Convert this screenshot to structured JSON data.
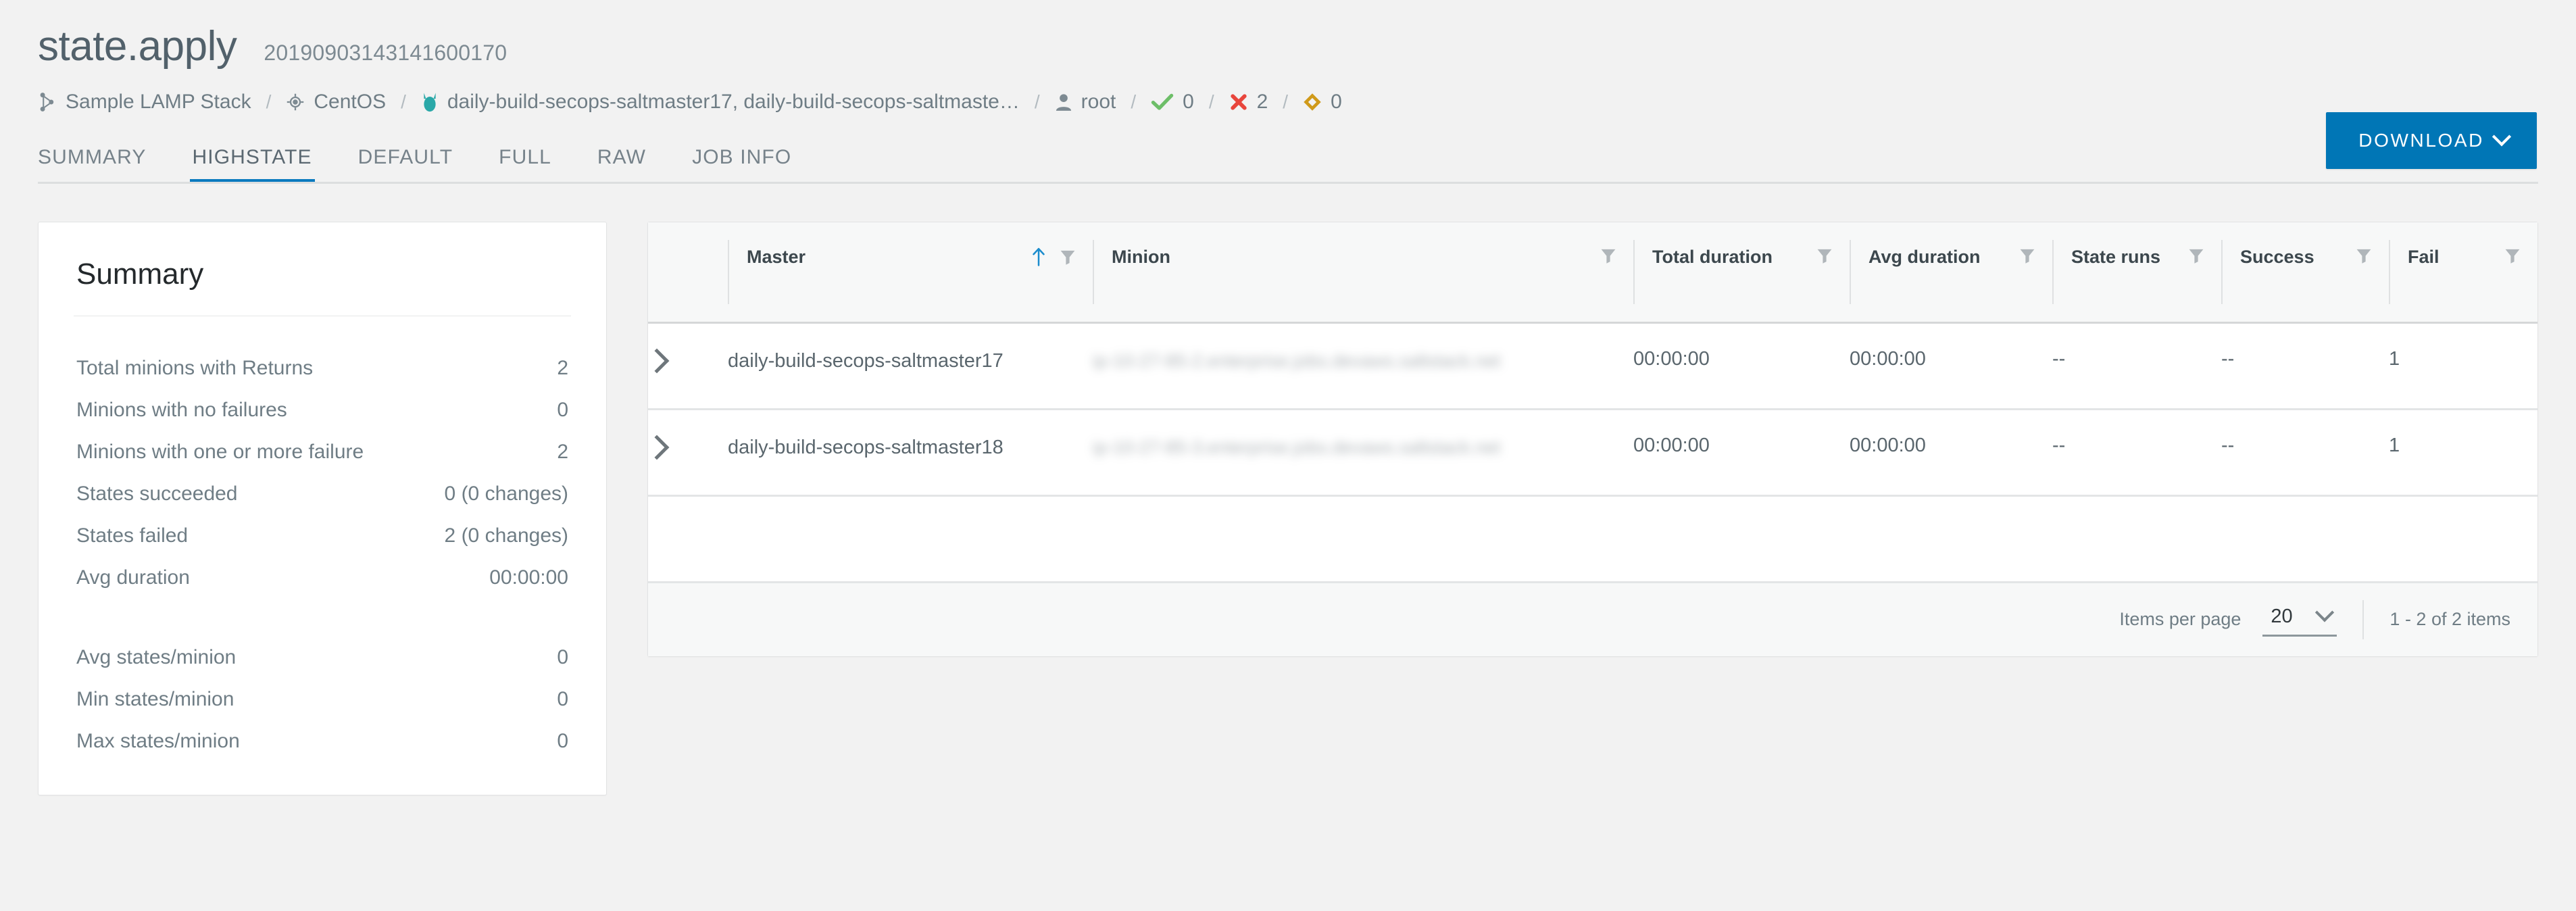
{
  "header": {
    "title": "state.apply",
    "job_id": "20190903143141600170"
  },
  "breadcrumb": {
    "items": [
      {
        "icon": "nodes-icon",
        "label": "Sample LAMP Stack"
      },
      {
        "icon": "target-icon",
        "label": "CentOS"
      },
      {
        "icon": "salt-minion-icon",
        "label": "daily-build-secops-saltmaster17, daily-build-secops-saltmaste…"
      },
      {
        "icon": "user-icon",
        "label": "root"
      },
      {
        "icon": "check-icon",
        "label": "0",
        "color": "#6dbe68"
      },
      {
        "icon": "x-icon",
        "label": "2",
        "color": "#e8453c"
      },
      {
        "icon": "diamond-icon",
        "label": "0",
        "color": "#d09a1a"
      }
    ],
    "separator": "/"
  },
  "tabs": {
    "items": [
      {
        "label": "SUMMARY",
        "active": false
      },
      {
        "label": "HIGHSTATE",
        "active": true
      },
      {
        "label": "DEFAULT",
        "active": false
      },
      {
        "label": "FULL",
        "active": false
      },
      {
        "label": "RAW",
        "active": false
      },
      {
        "label": "JOB INFO",
        "active": false
      }
    ],
    "active_color": "#0a7abf"
  },
  "toolbar": {
    "download_label": "DOWNLOAD",
    "download_color": "#0076b6"
  },
  "summary": {
    "title": "Summary",
    "group_one": [
      {
        "label": "Total minions with Returns",
        "value": "2"
      },
      {
        "label": "Minions with no failures",
        "value": "0"
      },
      {
        "label": "Minions with one or more failure",
        "value": "2"
      },
      {
        "label": "States succeeded",
        "value": "0 (0 changes)"
      },
      {
        "label": "States failed",
        "value": "2 (0 changes)"
      },
      {
        "label": "Avg duration",
        "value": "00:00:00"
      }
    ],
    "group_two": [
      {
        "label": "Avg states/minion",
        "value": "0"
      },
      {
        "label": "Min states/minion",
        "value": "0"
      },
      {
        "label": "Max states/minion",
        "value": "0"
      }
    ]
  },
  "table": {
    "columns": [
      {
        "key": "expand",
        "label": "",
        "sorted": false,
        "filter": false
      },
      {
        "key": "master",
        "label": "Master",
        "sorted": true,
        "sort_dir": "asc",
        "filter": true
      },
      {
        "key": "minion",
        "label": "Minion",
        "sorted": false,
        "filter": true
      },
      {
        "key": "total_duration",
        "label": "Total duration",
        "sorted": false,
        "filter": true
      },
      {
        "key": "avg_duration",
        "label": "Avg duration",
        "sorted": false,
        "filter": true
      },
      {
        "key": "state_runs",
        "label": "State runs",
        "sorted": false,
        "filter": true
      },
      {
        "key": "success",
        "label": "Success",
        "sorted": false,
        "filter": true
      },
      {
        "key": "fail",
        "label": "Fail",
        "sorted": false,
        "filter": true
      }
    ],
    "rows": [
      {
        "master": "daily-build-secops-saltmaster17",
        "minion": "ip-10-27-85-2.enterprise.jobs.devaws.saltstack.net",
        "minion_redacted": true,
        "total_duration": "00:00:00",
        "avg_duration": "00:00:00",
        "state_runs": "--",
        "success": "--",
        "fail": "1"
      },
      {
        "master": "daily-build-secops-saltmaster18",
        "minion": "ip-10-27-85-3.enterprise.jobs.devaws.saltstack.net",
        "minion_redacted": true,
        "total_duration": "00:00:00",
        "avg_duration": "00:00:00",
        "state_runs": "--",
        "success": "--",
        "fail": "1"
      }
    ],
    "footer": {
      "items_per_page_label": "Items per page",
      "items_per_page_value": "20",
      "range_label": "1 - 2 of 2 items"
    }
  }
}
